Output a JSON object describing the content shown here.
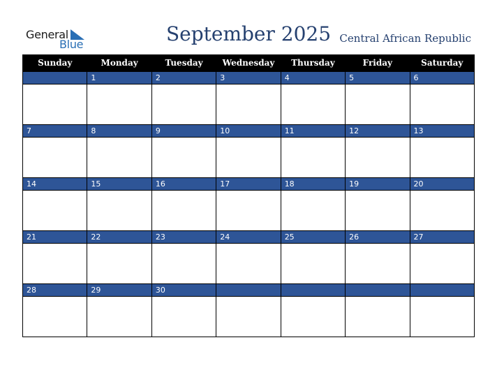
{
  "logo": {
    "line1": "General",
    "line2": "Blue"
  },
  "header": {
    "title": "September 2025",
    "country": "Central African Republic"
  },
  "colors": {
    "accent": "#2e5597",
    "title": "#25406f",
    "header_bg": "#000000"
  },
  "weekdays": [
    "Sunday",
    "Monday",
    "Tuesday",
    "Wednesday",
    "Thursday",
    "Friday",
    "Saturday"
  ],
  "weeks": [
    [
      "",
      "1",
      "2",
      "3",
      "4",
      "5",
      "6"
    ],
    [
      "7",
      "8",
      "9",
      "10",
      "11",
      "12",
      "13"
    ],
    [
      "14",
      "15",
      "16",
      "17",
      "18",
      "19",
      "20"
    ],
    [
      "21",
      "22",
      "23",
      "24",
      "25",
      "26",
      "27"
    ],
    [
      "28",
      "29",
      "30",
      "",
      "",
      "",
      ""
    ]
  ]
}
